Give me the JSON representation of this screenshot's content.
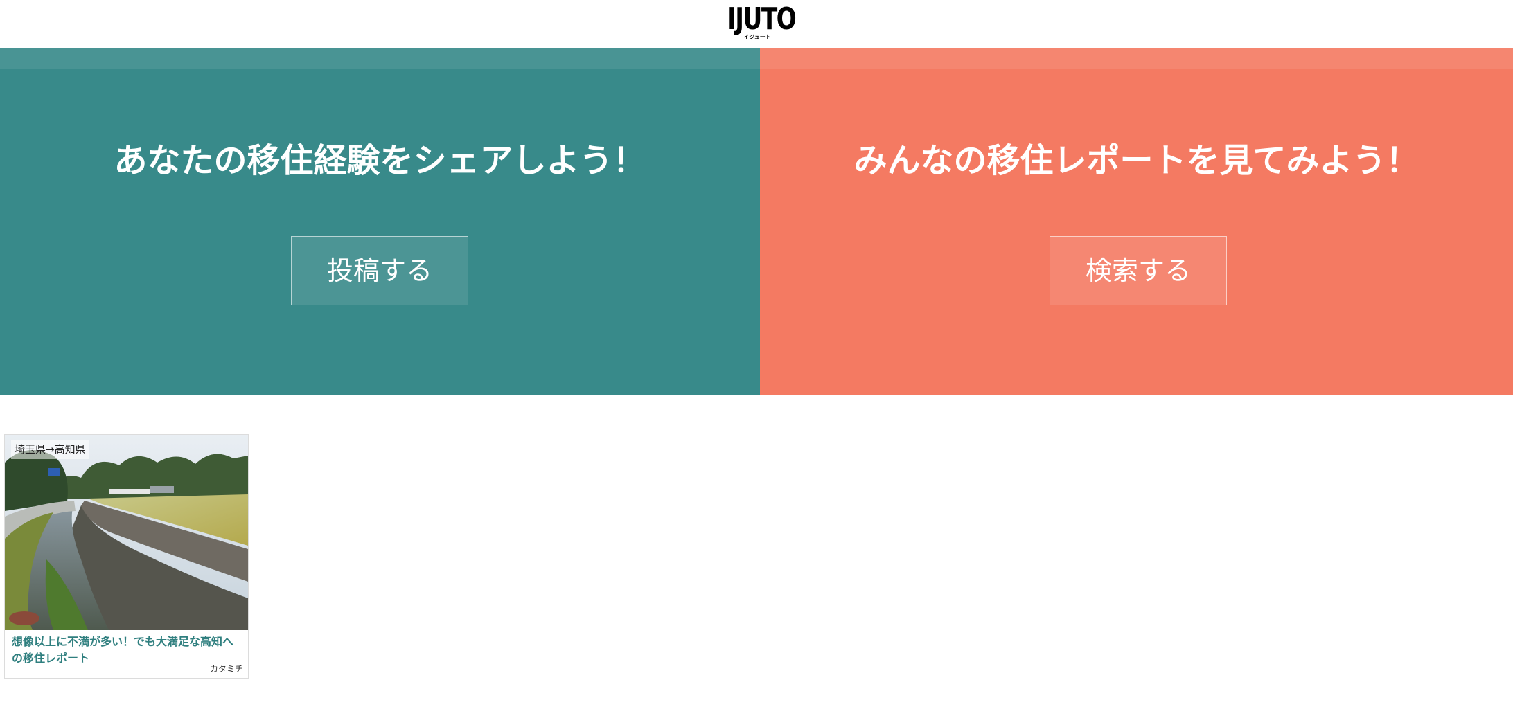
{
  "header": {
    "logo_text": "IJUTO",
    "logo_sub": "イジュート"
  },
  "panels": {
    "post": {
      "title": "あなたの移住経験をシェアしよう！",
      "button_label": "投稿する",
      "color": "#388a8a"
    },
    "search": {
      "title": "みんなの移住レポートを見てみよう！",
      "button_label": "検索する",
      "color": "#f47a62"
    }
  },
  "reports": [
    {
      "route": "埼玉県→高知県",
      "title": "想像以上に不満が多い！でも大満足な高知への移住レポート",
      "author": "カタミチ",
      "title_color": "#2f7f7f"
    }
  ]
}
